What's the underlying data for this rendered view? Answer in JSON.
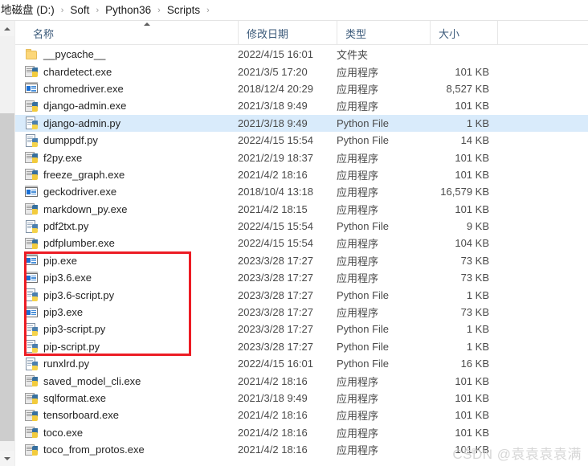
{
  "window": {
    "title": "Scripts"
  },
  "breadcrumb": {
    "separator": "›",
    "items": [
      {
        "label": "地磁盘 (D:)"
      },
      {
        "label": "Soft"
      },
      {
        "label": "Python36"
      },
      {
        "label": "Scripts"
      }
    ]
  },
  "columns": [
    {
      "key": "name",
      "label": "名称",
      "sorted": "asc"
    },
    {
      "key": "date",
      "label": "修改日期"
    },
    {
      "key": "type",
      "label": "类型"
    },
    {
      "key": "size",
      "label": "大小"
    }
  ],
  "scrollbar": {
    "up_icon": "chevron-up-icon",
    "down_icon": "chevron-down-icon"
  },
  "annotation": {
    "color": "#ec1c24",
    "highlights_rows": [
      "pip.exe",
      "pip3.6.exe",
      "pip3.6-script.py",
      "pip3.exe",
      "pip3-script.py",
      "pip-script.py"
    ]
  },
  "selection": {
    "selected_row": "django-admin.py",
    "color": "#d9ebfb"
  },
  "watermark": {
    "text": "CSDN @袁袁袁袁满",
    "overlay": "Ke"
  },
  "files": [
    {
      "name": "__pycache__",
      "icon": "folder-icon",
      "date": "2022/4/15 16:01",
      "type": "文件夹",
      "size": "",
      "selected": false
    },
    {
      "name": "chardetect.exe",
      "icon": "python-exe-icon",
      "date": "2021/3/5 17:20",
      "type": "应用程序",
      "size": "101 KB",
      "selected": false
    },
    {
      "name": "chromedriver.exe",
      "icon": "application-icon",
      "date": "2018/12/4 20:29",
      "type": "应用程序",
      "size": "8,527 KB",
      "selected": false
    },
    {
      "name": "django-admin.exe",
      "icon": "python-exe-icon",
      "date": "2021/3/18 9:49",
      "type": "应用程序",
      "size": "101 KB",
      "selected": false
    },
    {
      "name": "django-admin.py",
      "icon": "python-file-icon",
      "date": "2021/3/18 9:49",
      "type": "Python File",
      "size": "1 KB",
      "selected": true
    },
    {
      "name": "dumppdf.py",
      "icon": "python-file-icon",
      "date": "2022/4/15 15:54",
      "type": "Python File",
      "size": "14 KB",
      "selected": false
    },
    {
      "name": "f2py.exe",
      "icon": "python-exe-icon",
      "date": "2021/2/19 18:37",
      "type": "应用程序",
      "size": "101 KB",
      "selected": false
    },
    {
      "name": "freeze_graph.exe",
      "icon": "python-exe-icon",
      "date": "2021/4/2 18:16",
      "type": "应用程序",
      "size": "101 KB",
      "selected": false
    },
    {
      "name": "geckodriver.exe",
      "icon": "application-icon",
      "date": "2018/10/4 13:18",
      "type": "应用程序",
      "size": "16,579 KB",
      "selected": false
    },
    {
      "name": "markdown_py.exe",
      "icon": "python-exe-icon",
      "date": "2021/4/2 18:15",
      "type": "应用程序",
      "size": "101 KB",
      "selected": false
    },
    {
      "name": "pdf2txt.py",
      "icon": "python-file-icon",
      "date": "2022/4/15 15:54",
      "type": "Python File",
      "size": "9 KB",
      "selected": false
    },
    {
      "name": "pdfplumber.exe",
      "icon": "python-exe-icon",
      "date": "2022/4/15 15:54",
      "type": "应用程序",
      "size": "104 KB",
      "selected": false
    },
    {
      "name": "pip.exe",
      "icon": "application-icon",
      "date": "2023/3/28 17:27",
      "type": "应用程序",
      "size": "73 KB",
      "selected": false
    },
    {
      "name": "pip3.6.exe",
      "icon": "application-icon",
      "date": "2023/3/28 17:27",
      "type": "应用程序",
      "size": "73 KB",
      "selected": false
    },
    {
      "name": "pip3.6-script.py",
      "icon": "python-file-icon",
      "date": "2023/3/28 17:27",
      "type": "Python File",
      "size": "1 KB",
      "selected": false
    },
    {
      "name": "pip3.exe",
      "icon": "application-icon",
      "date": "2023/3/28 17:27",
      "type": "应用程序",
      "size": "73 KB",
      "selected": false
    },
    {
      "name": "pip3-script.py",
      "icon": "python-file-icon",
      "date": "2023/3/28 17:27",
      "type": "Python File",
      "size": "1 KB",
      "selected": false
    },
    {
      "name": "pip-script.py",
      "icon": "python-file-icon",
      "date": "2023/3/28 17:27",
      "type": "Python File",
      "size": "1 KB",
      "selected": false
    },
    {
      "name": "runxlrd.py",
      "icon": "python-file-icon",
      "date": "2022/4/15 16:01",
      "type": "Python File",
      "size": "16 KB",
      "selected": false
    },
    {
      "name": "saved_model_cli.exe",
      "icon": "python-exe-icon",
      "date": "2021/4/2 18:16",
      "type": "应用程序",
      "size": "101 KB",
      "selected": false
    },
    {
      "name": "sqlformat.exe",
      "icon": "python-exe-icon",
      "date": "2021/3/18 9:49",
      "type": "应用程序",
      "size": "101 KB",
      "selected": false
    },
    {
      "name": "tensorboard.exe",
      "icon": "python-exe-icon",
      "date": "2021/4/2 18:16",
      "type": "应用程序",
      "size": "101 KB",
      "selected": false
    },
    {
      "name": "toco.exe",
      "icon": "python-exe-icon",
      "date": "2021/4/2 18:16",
      "type": "应用程序",
      "size": "101 KB",
      "selected": false
    },
    {
      "name": "toco_from_protos.exe",
      "icon": "python-exe-icon",
      "date": "2021/4/2 18:16",
      "type": "应用程序",
      "size": "101 KB",
      "selected": false
    }
  ]
}
